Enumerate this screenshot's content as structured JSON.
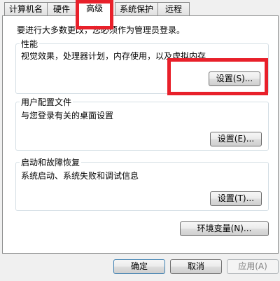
{
  "tabs": [
    {
      "label": "计算机名"
    },
    {
      "label": "硬件"
    },
    {
      "label": "高级"
    },
    {
      "label": "系统保护"
    },
    {
      "label": "远程"
    }
  ],
  "intro_text": "要进行大多数更改，您必须作为管理员登录。",
  "groups": {
    "performance": {
      "title": "性能",
      "description": "视觉效果，处理器计划，内存使用，以及虚拟内存",
      "button": "设置(S)..."
    },
    "user_profiles": {
      "title": "用户配置文件",
      "description": "与您登录有关的桌面设置",
      "button": "设置(E)..."
    },
    "startup_recovery": {
      "title": "启动和故障恢复",
      "description": "系统启动、系统失败和调试信息",
      "button": "设置(T)..."
    }
  },
  "env_button": "环境变量(N)...",
  "footer": {
    "ok": "确定",
    "cancel": "取消",
    "apply": "应用(A)"
  },
  "colors": {
    "highlight": "#e8202a",
    "panel_border": "#8e8f8f",
    "group_border": "#d5dfe5"
  }
}
